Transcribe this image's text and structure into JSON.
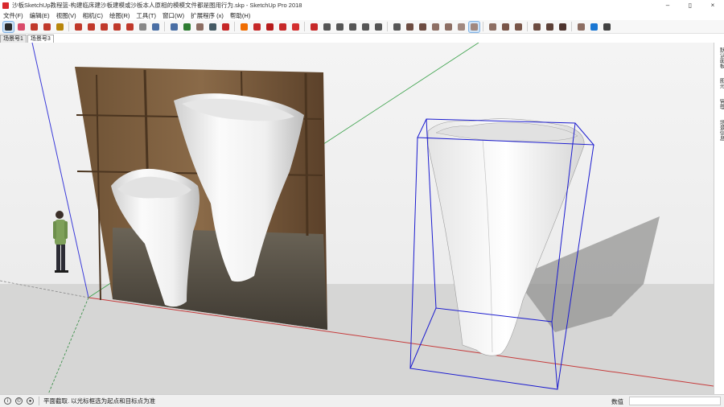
{
  "window": {
    "title": "沙板SketchUp教程篮-构建临床建沙板建模或沙板本人原相的模模文件都是图用行为.skp - SketchUp Pro 2018",
    "minimize": "–",
    "maximize": "▯",
    "close": "×"
  },
  "menu": {
    "items": [
      "文件(F)",
      "编辑(E)",
      "视图(V)",
      "相机(C)",
      "绘图(R)",
      "工具(T)",
      "窗口(W)",
      "扩展程序 (x)",
      "帮助(H)"
    ]
  },
  "toolbar": {
    "tools": [
      {
        "name": "select-tool-icon",
        "color": "#2b2b2b",
        "active": true
      },
      {
        "name": "eraser-tool-icon",
        "color": "#d94b6a"
      },
      {
        "name": "line-tool-icon",
        "color": "#c0392b"
      },
      {
        "name": "arc-tool-icon",
        "color": "#c0392b"
      },
      {
        "name": "shape-tool-icon",
        "color": "#b8860b"
      },
      {
        "name": "push-pull-icon",
        "color": "#c0392b"
      },
      {
        "name": "move-tool-icon",
        "color": "#c0392b"
      },
      {
        "name": "rotate-tool-icon",
        "color": "#c0392b"
      },
      {
        "name": "scale-tool-icon",
        "color": "#c0392b"
      },
      {
        "name": "offset-tool-icon",
        "color": "#c0392b"
      },
      {
        "name": "tape-measure-icon",
        "color": "#888888"
      },
      {
        "name": "text-tool-icon",
        "color": "#4a6fa5"
      },
      {
        "name": "paint-bucket-icon",
        "color": "#4a6fa5"
      },
      {
        "name": "orbit-icon",
        "color": "#2e7d32"
      },
      {
        "name": "pan-icon",
        "color": "#8d6e63"
      },
      {
        "name": "zoom-icon",
        "color": "#455a64"
      },
      {
        "name": "zoom-extents-icon",
        "color": "#c62828"
      },
      {
        "name": "section-plane-icon",
        "color": "#ef6c00"
      },
      {
        "name": "warehouse-icon",
        "color": "#c62828"
      },
      {
        "name": "extension-warehouse-icon",
        "color": "#b71c1c"
      },
      {
        "name": "layout-icon",
        "color": "#c62828"
      },
      {
        "name": "extension-manager-icon",
        "color": "#d32f2f"
      },
      {
        "name": "send-to-layout-icon",
        "color": "#c62828"
      },
      {
        "name": "iso-view-icon",
        "color": "#555555"
      },
      {
        "name": "top-view-icon",
        "color": "#555555"
      },
      {
        "name": "front-view-icon",
        "color": "#555555"
      },
      {
        "name": "right-view-icon",
        "color": "#555555"
      },
      {
        "name": "back-view-icon",
        "color": "#555555"
      },
      {
        "name": "left-view-icon",
        "color": "#555555"
      },
      {
        "name": "xray-style-icon",
        "color": "#6d4c41"
      },
      {
        "name": "back-edges-style-icon",
        "color": "#6d4c41"
      },
      {
        "name": "wireframe-style-icon",
        "color": "#8d6e63"
      },
      {
        "name": "hidden-line-style-icon",
        "color": "#8d6e63"
      },
      {
        "name": "shaded-style-icon",
        "color": "#a1887f"
      },
      {
        "name": "textured-style-icon",
        "color": "#a1887f",
        "active": true
      },
      {
        "name": "monochrome-style-icon",
        "color": "#8d6e63"
      },
      {
        "name": "section-fill-icon",
        "color": "#795548"
      },
      {
        "name": "section-cut-icon",
        "color": "#795548"
      },
      {
        "name": "display-sections-icon",
        "color": "#6d4c41"
      },
      {
        "name": "solid-tools-icon",
        "color": "#5d4037"
      },
      {
        "name": "sandbox-icon",
        "color": "#4e342e"
      },
      {
        "name": "follow-me-icon",
        "color": "#8d6e63"
      },
      {
        "name": "walk-icon",
        "color": "#1976d2"
      },
      {
        "name": "outliner-icon",
        "color": "#424242"
      }
    ]
  },
  "scene_tabs": [
    "场景号1",
    "场景号3"
  ],
  "right_panel": {
    "tabs": [
      "默认面板",
      "图元",
      "管理",
      "场景信息"
    ]
  },
  "status": {
    "hint": "平面截取. 以光标框选为起点和目标点为准",
    "measure_label": "数值",
    "measure_value": ""
  }
}
